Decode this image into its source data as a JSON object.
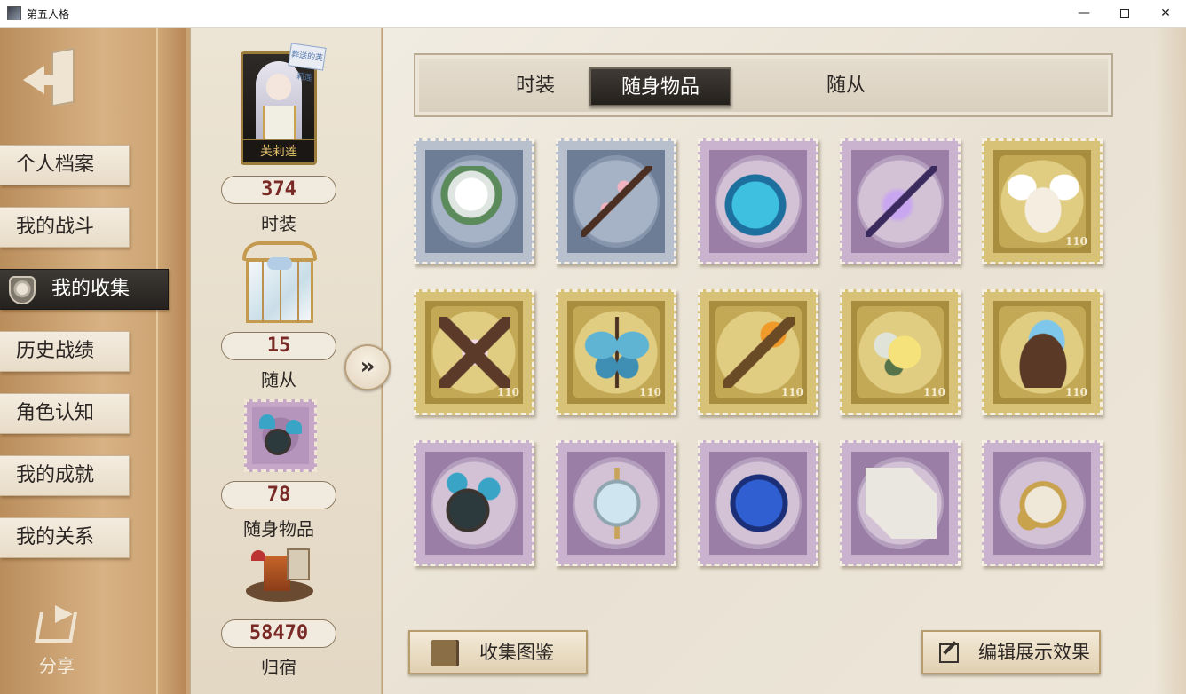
{
  "window": {
    "title": "第五人格",
    "minimize": "—",
    "close": "✕"
  },
  "sidebar": {
    "items": [
      {
        "label": "个人档案"
      },
      {
        "label": "我的战斗"
      },
      {
        "label": "我的收集"
      },
      {
        "label": "历史战绩"
      },
      {
        "label": "角色认知"
      },
      {
        "label": "我的成就"
      },
      {
        "label": "我的关系"
      }
    ],
    "active_index": 2,
    "share_label": "分享"
  },
  "summary": {
    "character_name": "芙莉莲",
    "character_tag": "葬送的芙莉莲",
    "costumes": {
      "count": "374",
      "label": "时装"
    },
    "followers": {
      "count": "15",
      "label": "随从"
    },
    "accessories": {
      "count": "78",
      "label": "随身物品"
    },
    "home": {
      "count": "58470",
      "label": "归宿"
    },
    "expand_icon": "»"
  },
  "tabs": {
    "items": [
      {
        "label": "时装"
      },
      {
        "label": "随身物品"
      },
      {
        "label": "随从"
      }
    ],
    "active_index": 1
  },
  "grid": {
    "items": [
      {
        "name": "white-rose-boutonniere",
        "frame": "blue",
        "icon": "white-rose-icon"
      },
      {
        "name": "plum-blossom-branch",
        "frame": "blue",
        "icon": "plum-branch-icon"
      },
      {
        "name": "crystal-whale",
        "frame": "purple",
        "icon": "whale-icon"
      },
      {
        "name": "violet-wand",
        "frame": "purple",
        "icon": "wand-icon"
      },
      {
        "name": "winged-letter",
        "frame": "gold",
        "icon": "winged-letter-icon",
        "badge": "110"
      },
      {
        "name": "ballerina-cross",
        "frame": "gold",
        "icon": "ballerina-icon",
        "badge": "110"
      },
      {
        "name": "blue-butterfly",
        "frame": "gold",
        "icon": "butterfly-icon",
        "badge": "110"
      },
      {
        "name": "flame-scepter",
        "frame": "gold",
        "icon": "scepter-icon",
        "badge": "110"
      },
      {
        "name": "yellow-rose-skull",
        "frame": "gold",
        "icon": "yellow-rose-icon",
        "badge": "110"
      },
      {
        "name": "azure-feather-nest",
        "frame": "gold",
        "icon": "feather-nest-icon",
        "badge": "110"
      },
      {
        "name": "bell-alarm-clock",
        "frame": "purple",
        "icon": "alarm-clock-icon"
      },
      {
        "name": "treble-clef-orb",
        "frame": "purple",
        "icon": "treble-clef-icon"
      },
      {
        "name": "sapphire-heart",
        "frame": "purple",
        "icon": "gem-heart-icon"
      },
      {
        "name": "crystal-pillow",
        "frame": "purple",
        "icon": "pillow-icon"
      },
      {
        "name": "golden-pocket-watch",
        "frame": "purple",
        "icon": "pocket-watch-icon"
      }
    ],
    "colors": {
      "blue": "#6d7d96",
      "purple": "#9a7ea6",
      "gold": "#a88d3e"
    }
  },
  "actions": {
    "gallery_label": "收集图鉴",
    "edit_label": "编辑展示效果"
  }
}
